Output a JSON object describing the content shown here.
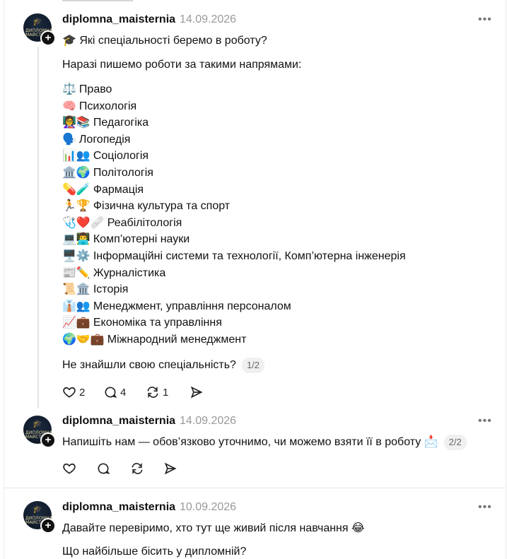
{
  "posts": [
    {
      "username": "diplomna_maisternia",
      "date": "14.09.2026",
      "more": "•••",
      "avatar_text": "ДИПЛОМНА МАЙСТЕРНЯ",
      "title": "🎓 Які спеціальності беремо в роботу?",
      "intro": "Наразі пишемо роботи за такими напрямами:",
      "directions": [
        {
          "icons": "⚖️",
          "label": "Право"
        },
        {
          "icons": "🧠",
          "label": "Психологія"
        },
        {
          "icons": "👩‍🏫📚",
          "label": "Педагогіка"
        },
        {
          "icons": "🗣️",
          "label": "Логопедія"
        },
        {
          "icons": "📊👥",
          "label": "Соціологія"
        },
        {
          "icons": "🏛️🌍",
          "label": "Політологія"
        },
        {
          "icons": "💊🧪",
          "label": "Фармація"
        },
        {
          "icons": "🏃🏆",
          "label": "Фізична культура та спорт"
        },
        {
          "icons": "🩺❤️🩹",
          "label": "Реабілітологія"
        },
        {
          "icons": "💻👨‍💻",
          "label": "Комп’ютерні науки"
        },
        {
          "icons": "🖥️⚙️",
          "label": "Інформаційні системи та технології, Комп’ютерна інженерія"
        },
        {
          "icons": "📰✏️",
          "label": "Журналістика"
        },
        {
          "icons": "📜🏛️",
          "label": "Історія"
        },
        {
          "icons": "👔👥",
          "label": "Менеджмент, управління персоналом"
        },
        {
          "icons": "📈💼",
          "label": "Економіка та управління"
        },
        {
          "icons": "🌍🤝💼",
          "label": "Міжнародний менеджмент"
        }
      ],
      "footer_text": "Не знайшли свою спеціальність?",
      "pager": "1/2",
      "likes": "2",
      "comments": "4",
      "reposts": "1"
    },
    {
      "username": "diplomna_maisternia",
      "date": "14.09.2026",
      "more": "•••",
      "avatar_text": "ДИПЛОМНА МАЙСТЕРНЯ",
      "text": "Напишіть нам — обов’язково уточнимо, чи можемо взяти її в роботу 📩",
      "pager": "2/2"
    },
    {
      "username": "diplomna_maisternia",
      "date": "10.09.2026",
      "more": "•••",
      "avatar_text": "ДИПЛОМНА МАЙСТЕРНЯ",
      "text1": "Давайте перевіримо, хто тут ще живий після навчання 😂",
      "text2": "Що найбільше бісить у дипломній?"
    }
  ],
  "icons": {
    "like": "heart-icon",
    "comment": "comment-bubble-icon",
    "repost": "repost-icon",
    "share": "share-send-icon",
    "avatar_badge": "plus-icon"
  }
}
